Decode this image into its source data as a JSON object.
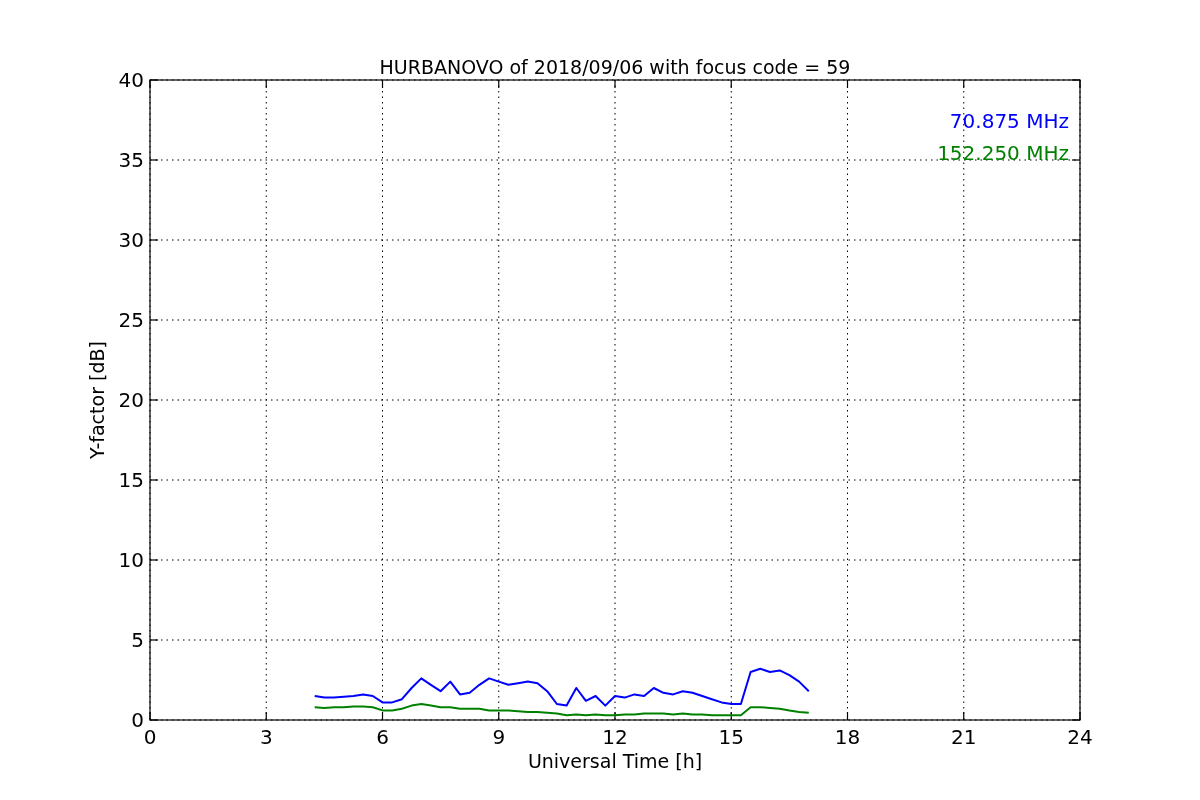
{
  "chart_data": {
    "type": "line",
    "title": "HURBANOVO of 2018/09/06 with focus code = 59",
    "xlabel": "Universal Time [h]",
    "ylabel": "Y-factor [dB]",
    "x": [
      4.25,
      4.5,
      4.75,
      5.0,
      5.25,
      5.5,
      5.75,
      6.0,
      6.25,
      6.5,
      6.75,
      7.0,
      7.25,
      7.5,
      7.75,
      8.0,
      8.25,
      8.5,
      8.75,
      9.0,
      9.25,
      9.5,
      9.75,
      10.0,
      10.25,
      10.5,
      10.75,
      11.0,
      11.25,
      11.5,
      11.75,
      12.0,
      12.25,
      12.5,
      12.75,
      13.0,
      13.25,
      13.5,
      13.75,
      14.0,
      14.25,
      14.5,
      14.75,
      15.0,
      15.25,
      15.5,
      15.75,
      16.0,
      16.25,
      16.5,
      16.75,
      17.0
    ],
    "series": [
      {
        "name": "70.875 MHz",
        "color": "#0000ff",
        "values": [
          1.5,
          1.4,
          1.4,
          1.45,
          1.5,
          1.6,
          1.5,
          1.1,
          1.1,
          1.3,
          2.0,
          2.6,
          2.2,
          1.8,
          2.4,
          1.6,
          1.7,
          2.2,
          2.6,
          2.4,
          2.2,
          2.3,
          2.4,
          2.3,
          1.8,
          1.0,
          0.9,
          2.0,
          1.2,
          1.5,
          0.9,
          1.5,
          1.4,
          1.6,
          1.5,
          2.0,
          1.7,
          1.6,
          1.8,
          1.7,
          1.5,
          1.3,
          1.1,
          1.0,
          1.0,
          3.0,
          3.2,
          3.0,
          3.1,
          2.8,
          2.4,
          1.8
        ]
      },
      {
        "name": "152.250 MHz",
        "color": "#008000",
        "values": [
          0.8,
          0.75,
          0.8,
          0.8,
          0.85,
          0.85,
          0.8,
          0.6,
          0.6,
          0.7,
          0.9,
          1.0,
          0.9,
          0.8,
          0.8,
          0.7,
          0.7,
          0.7,
          0.6,
          0.6,
          0.6,
          0.55,
          0.5,
          0.5,
          0.45,
          0.4,
          0.3,
          0.35,
          0.3,
          0.35,
          0.3,
          0.3,
          0.35,
          0.35,
          0.4,
          0.4,
          0.4,
          0.35,
          0.4,
          0.35,
          0.35,
          0.3,
          0.3,
          0.3,
          0.3,
          0.8,
          0.8,
          0.75,
          0.7,
          0.6,
          0.5,
          0.45
        ]
      }
    ],
    "grid": true,
    "xlim": [
      0,
      24
    ],
    "ylim": [
      0,
      40
    ],
    "xticks": [
      0,
      3,
      6,
      9,
      12,
      15,
      18,
      21,
      24
    ],
    "yticks": [
      0,
      5,
      10,
      15,
      20,
      25,
      30,
      35,
      40
    ]
  }
}
